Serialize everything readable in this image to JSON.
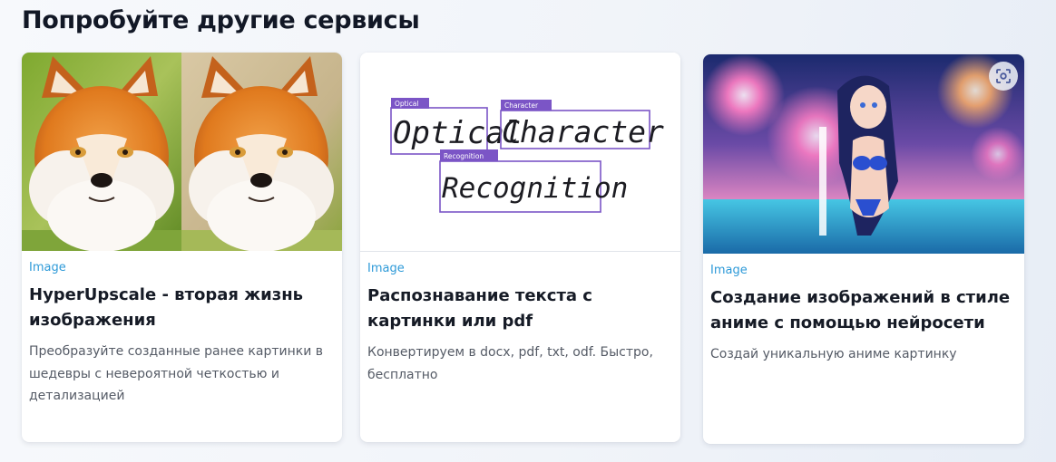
{
  "section": {
    "title": "Попробуйте другие сервисы"
  },
  "cards": [
    {
      "category": "Image",
      "title": "HyperUpscale - вторая жизнь изображения",
      "description": "Преобразуйте созданные ранее картинки в шедевры с невероятной четкостью и детализацией",
      "image": "fox-before-after-image"
    },
    {
      "category": "Image",
      "title": "Распознавание текста с картинки или pdf",
      "description": "Конвертируем в docx, pdf, txt, odf. Быстро, бесплатно",
      "image": "ocr-handwriting-image",
      "ocr_words": [
        "Optical",
        "Character",
        "Recognition"
      ],
      "ocr_tags": [
        "Optical",
        "Character",
        "Recognition"
      ]
    },
    {
      "category": "Image",
      "title": "Создание изображений в стиле аниме с помощью нейросети",
      "description": "Создай уникальную аниме картинку",
      "image": "anime-fireworks-image",
      "overlay_icon": "scan-icon"
    }
  ],
  "colors": {
    "category": "#2e9ad8",
    "ocr_box": "#7b55c6",
    "title": "#121826"
  }
}
